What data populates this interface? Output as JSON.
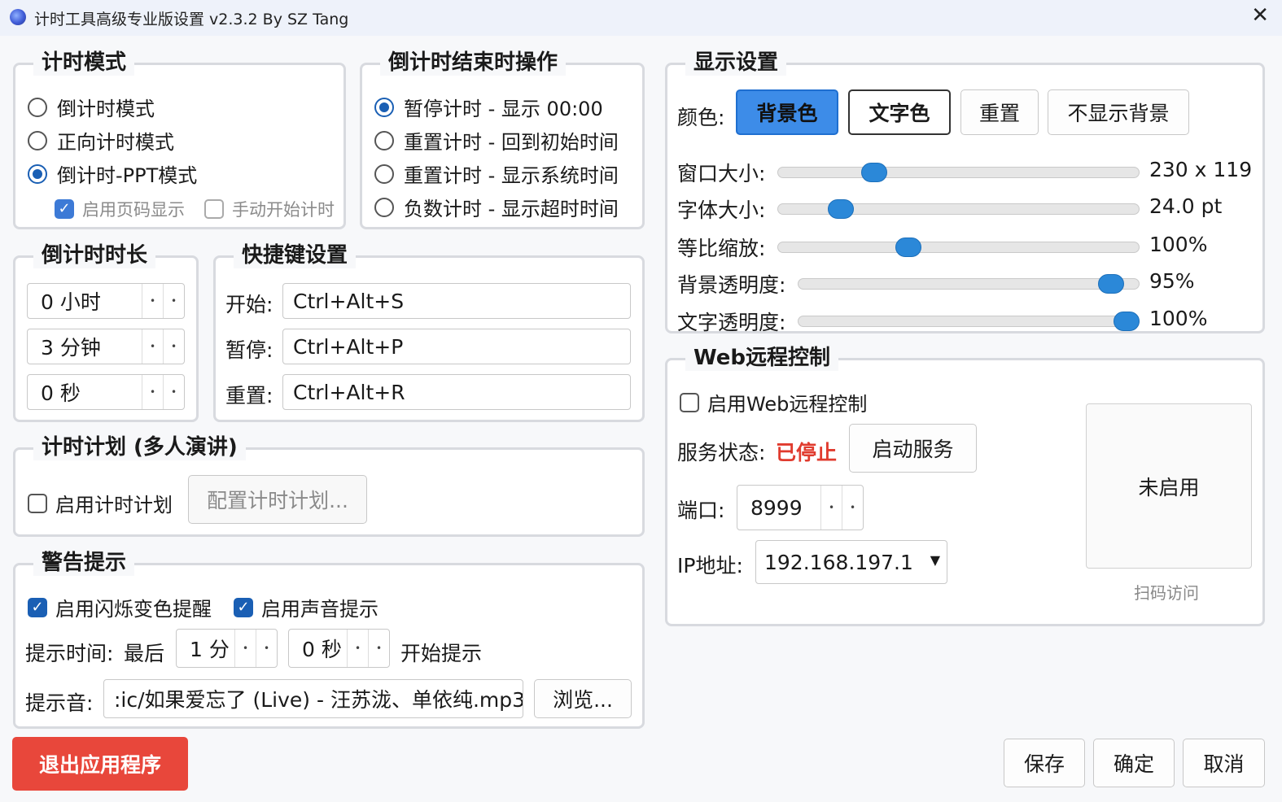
{
  "window": {
    "title": "计时工具高级专业版设置 v2.3.2 By SZ Tang",
    "close_glyph": "✕"
  },
  "timing_mode": {
    "title": "计时模式",
    "options": [
      {
        "label": "倒计时模式",
        "checked": false
      },
      {
        "label": "正向计时模式",
        "checked": false
      },
      {
        "label": "倒计时-PPT模式",
        "checked": true
      }
    ],
    "show_page_number": {
      "label": "启用页码显示",
      "checked": true
    },
    "manual_start": {
      "label": "手动开始计时",
      "checked": false
    }
  },
  "end_action": {
    "title": "倒计时结束时操作",
    "options": [
      {
        "label": "暂停计时 - 显示 00:00",
        "checked": true
      },
      {
        "label": "重置计时 - 回到初始时间",
        "checked": false
      },
      {
        "label": "重置计时 - 显示系统时间",
        "checked": false
      },
      {
        "label": "负数计时 - 显示超时时间",
        "checked": false
      }
    ]
  },
  "duration": {
    "title": "倒计时时长",
    "hours": "0 小时",
    "minutes": "3 分钟",
    "seconds": "0 秒"
  },
  "hotkeys": {
    "title": "快捷键设置",
    "start_label": "开始:",
    "start_value": "Ctrl+Alt+S",
    "pause_label": "暂停:",
    "pause_value": "Ctrl+Alt+P",
    "reset_label": "重置:",
    "reset_value": "Ctrl+Alt+R"
  },
  "plan": {
    "title": "计时计划 (多人演讲)",
    "enable_label": "启用计时计划",
    "configure_button": "配置计时计划..."
  },
  "warning": {
    "title": "警告提示",
    "flash_label": "启用闪烁变色提醒",
    "sound_label": "启用声音提示",
    "time_label": "提示时间:",
    "last_label": "最后",
    "minutes_value": "1 分",
    "seconds_value": "0 秒",
    "start_hint": "开始提示",
    "sound_file_label": "提示音:",
    "sound_file_value": ":ic/如果爱忘了 (Live) - 汪苏泷、单依纯.mp3",
    "browse_button": "浏览..."
  },
  "display": {
    "title": "显示设置",
    "color_label": "颜色:",
    "bg_color_button": "背景色",
    "text_color_button": "文字色",
    "reset_button": "重置",
    "no_bg_button": "不显示背景",
    "sliders": [
      {
        "label": "窗口大小:",
        "value_text": "230 x 119",
        "fraction": 0.25
      },
      {
        "label": "字体大小:",
        "value_text": "24.0 pt",
        "fraction": 0.15
      },
      {
        "label": "等比缩放:",
        "value_text": "100%",
        "fraction": 0.35
      },
      {
        "label": "背景透明度:",
        "value_text": "95%",
        "fraction": 0.95
      },
      {
        "label": "文字透明度:",
        "value_text": "100%",
        "fraction": 1.0
      }
    ]
  },
  "web": {
    "title": "Web远程控制",
    "enable_label": "启用Web远程控制",
    "status_label": "服务状态:",
    "status_value": "已停止",
    "start_service_button": "启动服务",
    "port_label": "端口:",
    "port_value": "8999",
    "ip_label": "IP地址:",
    "ip_value": "192.168.197.1",
    "qr_text": "未启用",
    "qr_caption": "扫码访问"
  },
  "footer": {
    "exit_button": "退出应用程序",
    "save_button": "保存",
    "ok_button": "确定",
    "cancel_button": "取消"
  },
  "colors": {
    "accent": "#1a5fb4",
    "primary_button": "#3d8ce8",
    "danger_button": "#e8473b",
    "status_stopped": "#e03b2e",
    "slider_thumb": "#2b88d8"
  }
}
